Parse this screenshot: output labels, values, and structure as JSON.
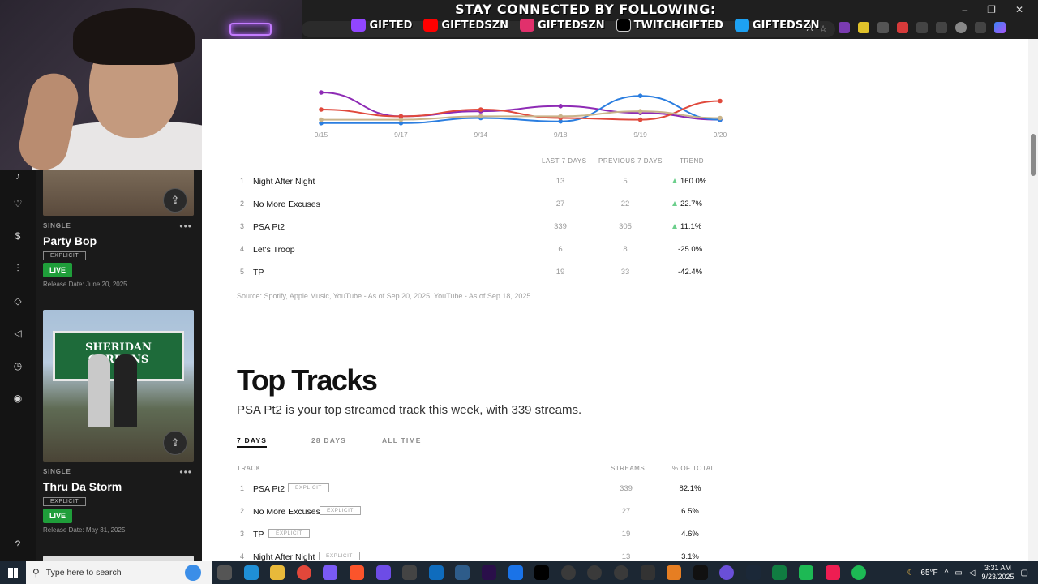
{
  "banner": {
    "title": "STAY CONNECTED BY FOLLOWING:",
    "socials": [
      {
        "icon": "twitch-icon",
        "color": "#9146ff",
        "handle": "GIFTED"
      },
      {
        "icon": "youtube-icon",
        "color": "#ff0000",
        "handle": "GIFTEDSZN"
      },
      {
        "icon": "instagram-icon",
        "color": "#e1306c",
        "handle": "GIFTEDSZN"
      },
      {
        "icon": "tiktok-icon",
        "color": "#000000",
        "handle": "TWITCHGIFTED"
      },
      {
        "icon": "twitter-icon",
        "color": "#1da1f2",
        "handle": "GIFTEDSZN"
      }
    ]
  },
  "sidebar": {
    "releases": [
      {
        "type": "SINGLE",
        "title": "Party Bop",
        "explicit": "EXPLICIT",
        "status": "LIVE",
        "release_date": "Release Date: June 20, 2025"
      },
      {
        "type": "SINGLE",
        "title": "Thru Da Storm",
        "explicit": "EXPLICIT",
        "status": "LIVE",
        "release_date": "Release Date: May 31, 2025",
        "art_sign_text": "SHERIDAN GARDENS"
      }
    ],
    "more_label": "•••"
  },
  "trend_table": {
    "headers": {
      "last7": "LAST 7 DAYS",
      "prev7": "PREVIOUS 7 DAYS",
      "trend": "TREND"
    },
    "rows": [
      {
        "idx": "1",
        "name": "Night After Night",
        "last7": "13",
        "prev7": "5",
        "trend": "160.0%",
        "up": true
      },
      {
        "idx": "2",
        "name": "No More Excuses",
        "last7": "27",
        "prev7": "22",
        "trend": "22.7%",
        "up": true
      },
      {
        "idx": "3",
        "name": "PSA Pt2",
        "last7": "339",
        "prev7": "305",
        "trend": "11.1%",
        "up": true
      },
      {
        "idx": "4",
        "name": "Let's Troop",
        "last7": "6",
        "prev7": "8",
        "trend": "-25.0%",
        "up": false
      },
      {
        "idx": "5",
        "name": "TP",
        "last7": "19",
        "prev7": "33",
        "trend": "-42.4%",
        "up": false
      }
    ],
    "source": "Source: Spotify, Apple Music, YouTube - As of Sep 20, 2025, YouTube - As of Sep 18, 2025"
  },
  "chart_data": {
    "type": "line",
    "x": [
      "9/15",
      "9/17",
      "9/14",
      "9/18",
      "9/19",
      "9/20"
    ],
    "series": [
      {
        "color": "#8e2bb5",
        "values": [
          10,
          3,
          4.5,
          6,
          4,
          2
        ]
      },
      {
        "color": "#2b7ee0",
        "values": [
          1,
          1,
          2.5,
          1.5,
          9,
          2
        ]
      },
      {
        "color": "#e0493c",
        "values": [
          5,
          3,
          5,
          2.5,
          2,
          7.5
        ]
      },
      {
        "color": "#c9b48a",
        "values": [
          2,
          2,
          3,
          3,
          4.5,
          2.5
        ]
      }
    ]
  },
  "top_tracks": {
    "title": "Top Tracks",
    "subtitle": "PSA Pt2 is your top streamed track this week, with 339 streams.",
    "tabs": [
      "7 DAYS",
      "28 DAYS",
      "ALL TIME"
    ],
    "headers": {
      "track": "TRACK",
      "streams": "STREAMS",
      "pct": "% OF TOTAL"
    },
    "rows": [
      {
        "idx": "1",
        "name": "PSA Pt2",
        "tag": "EXPLICIT",
        "streams": "339",
        "pct": "82.1%"
      },
      {
        "idx": "2",
        "name": "No More Excuses",
        "tag": "EXPLICIT",
        "streams": "27",
        "pct": "6.5%"
      },
      {
        "idx": "3",
        "name": "TP",
        "tag": "EXPLICIT",
        "streams": "19",
        "pct": "4.6%"
      },
      {
        "idx": "4",
        "name": "Night After Night",
        "tag": "EXPLICIT",
        "streams": "13",
        "pct": "3.1%"
      }
    ]
  },
  "taskbar": {
    "search_placeholder": "Type here to search",
    "weather": "65°F",
    "time": "3:31 AM",
    "date": "9/23/2025"
  }
}
